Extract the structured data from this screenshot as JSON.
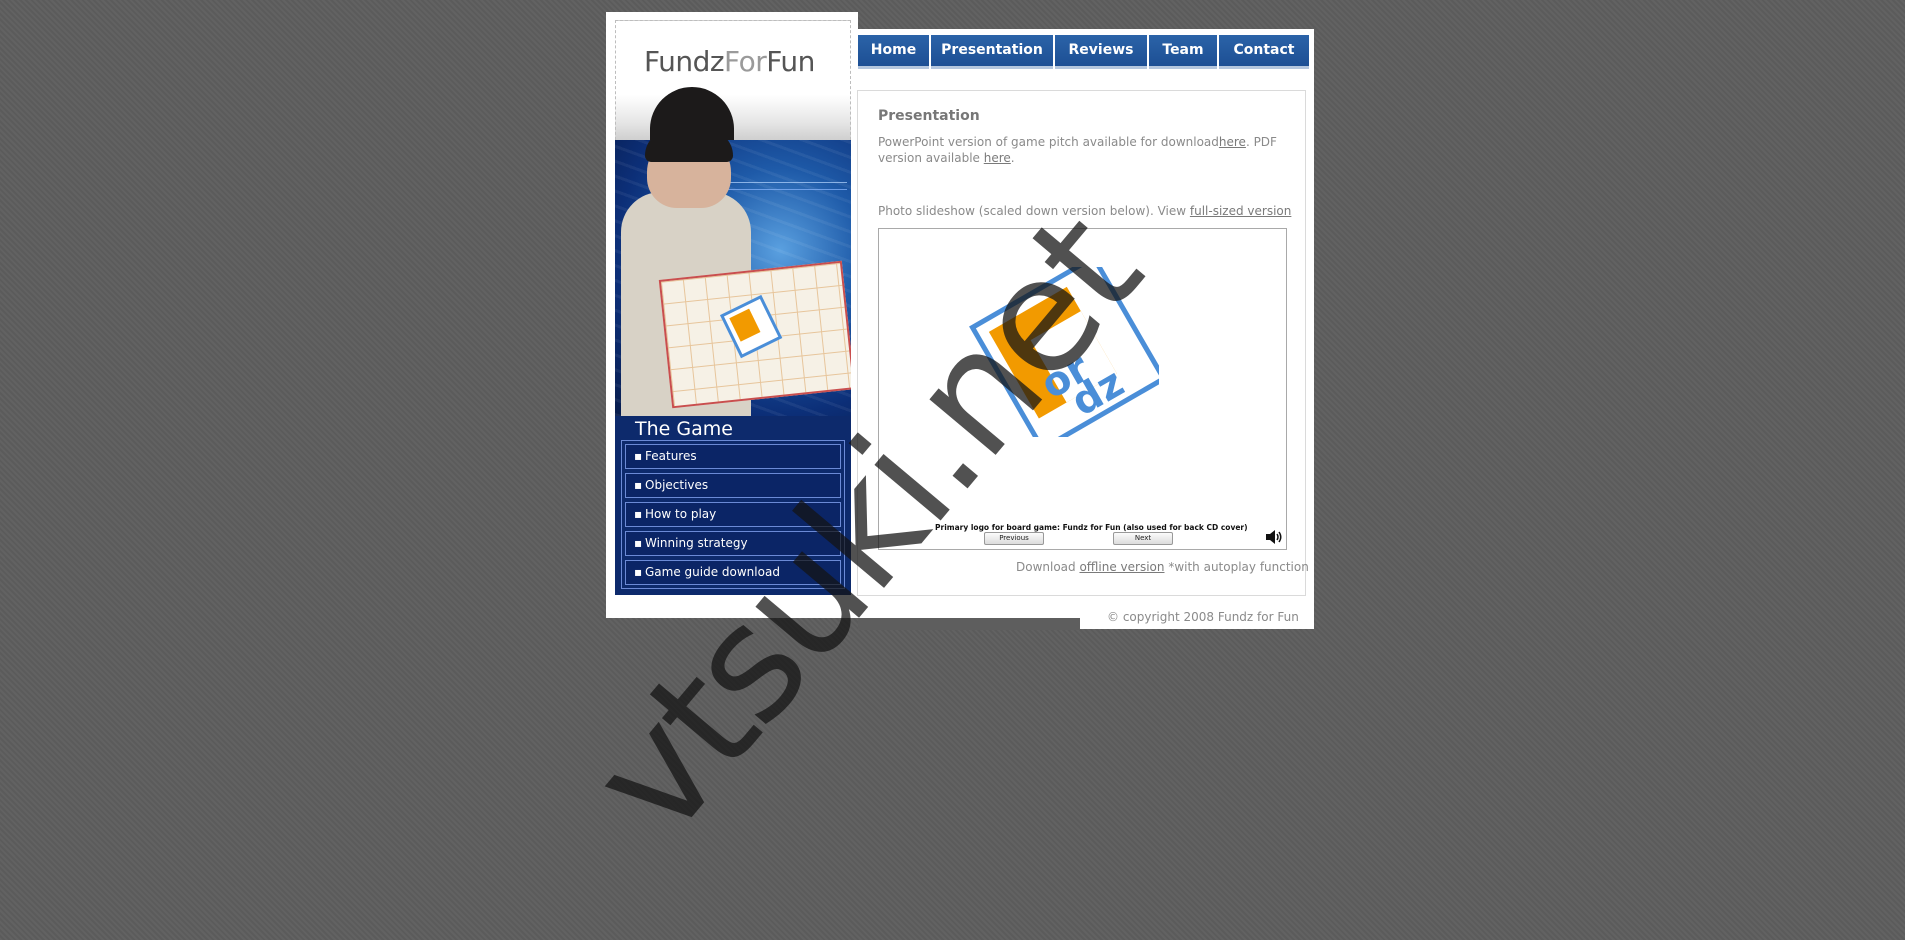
{
  "logo": {
    "part1": "Fundz",
    "part2": "For",
    "part3": "Fun"
  },
  "nav": [
    {
      "label": "Home"
    },
    {
      "label": "Presentation"
    },
    {
      "label": "Reviews"
    },
    {
      "label": "Team"
    },
    {
      "label": "Contact"
    }
  ],
  "sidebar": {
    "title": "The Game",
    "items": [
      {
        "label": "Features"
      },
      {
        "label": "Objectives"
      },
      {
        "label": "How to play"
      },
      {
        "label": "Winning strategy"
      },
      {
        "label": "Game guide download"
      }
    ]
  },
  "main": {
    "title": "Presentation",
    "ppt_text": "PowerPoint version of game pitch available for download",
    "ppt_link": "here",
    "pdf_text": ". PDF version available ",
    "pdf_link": "here",
    "pdf_end": ".",
    "slideshow_text": "Photo slideshow (scaled down version below). View ",
    "slideshow_link": "full-sized version",
    "slide_caption": "Primary logo for board game: Fundz for Fun (also used for back CD cover)",
    "prev_label": "Previous",
    "next_label": "Next",
    "download_text": "Download ",
    "download_link": "offline version",
    "download_note": " *with autoplay function"
  },
  "footer": {
    "copyright": "© copyright 2008 Fundz for Fun"
  },
  "watermark": "vtsuki.net",
  "colors": {
    "nav_blue": "#1d4f94",
    "sidebar_blue": "#0d2a6c",
    "logo_orange": "#f29a00",
    "logo_blue": "#4a8ed8",
    "background": "#5e5e5e"
  }
}
